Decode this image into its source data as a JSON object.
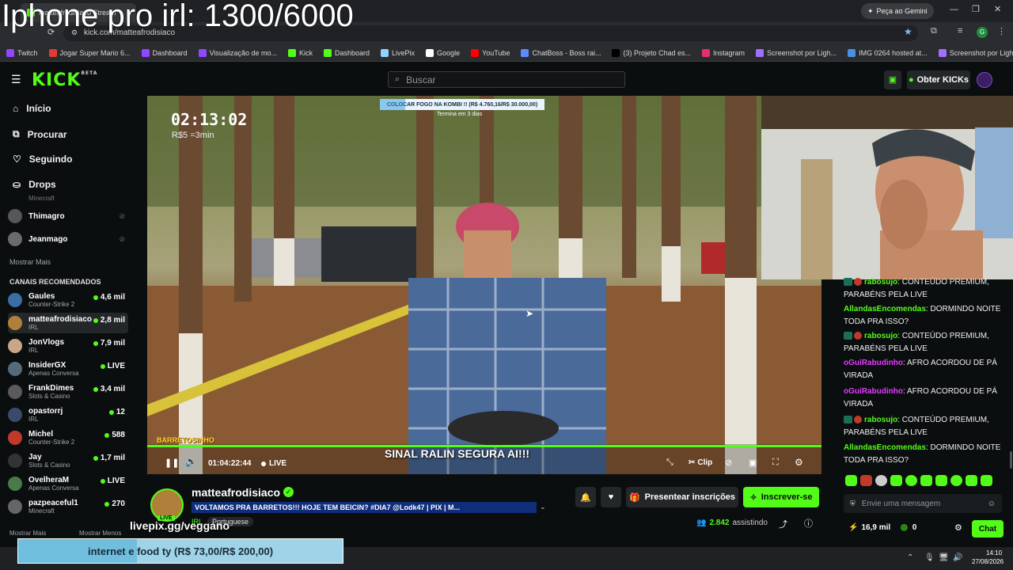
{
  "overlay": {
    "title": "Iphone pro irl: 1300/6000",
    "livepix": "livepix.gg/veggano",
    "goal_bar": "internet e food ty (R$ 73,00/R$ 200,00)"
  },
  "browser": {
    "tab_title": "matteafrodisiaco Stream",
    "url": "kick.com/matteafrodisiaco",
    "gemini": "Peça ao Gemini",
    "bookmarks": [
      {
        "label": "Twitch",
        "color": "#9146ff"
      },
      {
        "label": "Jogar Super Mario 6...",
        "color": "#e03c31"
      },
      {
        "label": "Dashboard",
        "color": "#9146ff"
      },
      {
        "label": "Visualização de mo...",
        "color": "#9146ff"
      },
      {
        "label": "Kick",
        "color": "#53fc18"
      },
      {
        "label": "Dashboard",
        "color": "#53fc18"
      },
      {
        "label": "LivePix",
        "color": "#8fd3ff"
      },
      {
        "label": "Google",
        "color": "#ffffff"
      },
      {
        "label": "YouTube",
        "color": "#ff0000"
      },
      {
        "label": "ChatBoss - Boss rai...",
        "color": "#5b8cff"
      },
      {
        "label": "(3) Projeto Chad es...",
        "color": "#000000"
      },
      {
        "label": "Instagram",
        "color": "#e1306c"
      },
      {
        "label": "Screenshot por Ligh...",
        "color": "#a070ff"
      },
      {
        "label": "IMG 0264 hosted at...",
        "color": "#4a90e2"
      },
      {
        "label": "Screenshot por Ligh...",
        "color": "#a070ff"
      }
    ]
  },
  "kick": {
    "logo": "KICK",
    "logo_badge": "BETA",
    "search_placeholder": "Buscar",
    "get_kicks": "Obter KICKs"
  },
  "sidebar": {
    "nav": [
      {
        "label": "Início",
        "icon": "home-icon"
      },
      {
        "label": "Procurar",
        "icon": "browse-icon"
      },
      {
        "label": "Seguindo",
        "icon": "heart-icon"
      },
      {
        "label": "Drops",
        "icon": "drops-icon"
      }
    ],
    "following_partial": "Minecraft",
    "following": [
      {
        "name": "Thimagro",
        "color": "#888"
      },
      {
        "name": "Jeanmago",
        "color": "#aaa"
      }
    ],
    "show_more": "Mostrar Mais",
    "recommended_header": "CANAIS RECOMENDADOS",
    "recommended": [
      {
        "name": "Gaules",
        "cat": "Counter-Strike 2",
        "viewers": "4,6 mil",
        "color": "#3a6ea5"
      },
      {
        "name": "matteafrodisiaco",
        "cat": "IRL",
        "viewers": "2,8 mil",
        "color": "#b0803a"
      },
      {
        "name": "JonVlogs",
        "cat": "IRL",
        "viewers": "7,9 mil",
        "color": "#c9a68a"
      },
      {
        "name": "InsiderGX",
        "cat": "Apenas Conversa",
        "viewers": "LIVE",
        "color": "#556b7a"
      },
      {
        "name": "FrankDimes",
        "cat": "Slots & Casino",
        "viewers": "3,4 mil",
        "color": "#5a5a5a"
      },
      {
        "name": "opastorrj",
        "cat": "IRL",
        "viewers": "12",
        "color": "#3a4a6a"
      },
      {
        "name": "Michel",
        "cat": "Counter-Strike 2",
        "viewers": "588",
        "color": "#c0392b"
      },
      {
        "name": "Jay",
        "cat": "Slots & Casino",
        "viewers": "1,7 mil",
        "color": "#333"
      },
      {
        "name": "OvelheraM",
        "cat": "Apenas Conversa",
        "viewers": "LIVE",
        "color": "#4a7a4a"
      },
      {
        "name": "pazpeaceful1",
        "cat": "Minecraft",
        "viewers": "270",
        "color": "#666"
      }
    ],
    "show_more_2": "Mostrar Mais",
    "show_less": "Mostrar Menos"
  },
  "video": {
    "timer": "02:13:02",
    "timer_sub": "R$5 =3min",
    "goal_banner": "COLOCAR FOGO NA KOMBI !! (R$ 4.760,16/R$ 30.000,00)",
    "goal_sub": "Termina em 3 dias",
    "caption": "SINAL RALIN SEGURA AI!!!",
    "badge": "BARRETOSINHO",
    "elapsed": "01:04:22:44",
    "live": "LIVE",
    "clip": "Clip"
  },
  "stream": {
    "channel": "matteafrodisiaco",
    "title": "VOLTAMOS PRA BARRETOS!!! HOJE TEM BEICIN? #DIA7 @Lodk47 | PIX | M...",
    "category": "IRL",
    "language": "Portuguese",
    "viewers": "2.842",
    "viewers_label": "assistindo",
    "gift_subs": "Presentear inscrições",
    "subscribe": "Inscrever-se",
    "avatar_live": "LIVE"
  },
  "chat": {
    "messages": [
      {
        "user": "rabosujo",
        "text": "CONTEÚDO PREMIUM, PARABÉNS PELA LIVE",
        "color": "#53fc18"
      },
      {
        "user": "AllandasEncomendas",
        "text": "DORMINDO NOITE TODA PRA ISSO?",
        "color": "#53fc18"
      },
      {
        "user": "rabosujo",
        "text": "CONTEÚDO PREMIUM, PARABÉNS PELA LIVE",
        "color": "#53fc18"
      },
      {
        "user": "oGuiRabudinho",
        "text": "AFRO ACORDOU DE PÁ VIRADA",
        "color": "#e13cff"
      },
      {
        "user": "oGuiRabudinho",
        "text": "AFRO ACORDOU DE PÁ VIRADA",
        "color": "#e13cff"
      },
      {
        "user": "rabosujo",
        "text": "CONTEÚDO PREMIUM, PARABÉNS PELA LIVE",
        "color": "#53fc18"
      },
      {
        "user": "AllandasEncomendas",
        "text": "DORMINDO NOITE TODA PRA ISSO?",
        "color": "#53fc18"
      }
    ],
    "input_placeholder": "Envie uma mensagem",
    "kicks": "16,9 mil",
    "points": "0",
    "send": "Chat"
  },
  "taskbar": {
    "time": "14:10",
    "date": "27/08/2026"
  }
}
